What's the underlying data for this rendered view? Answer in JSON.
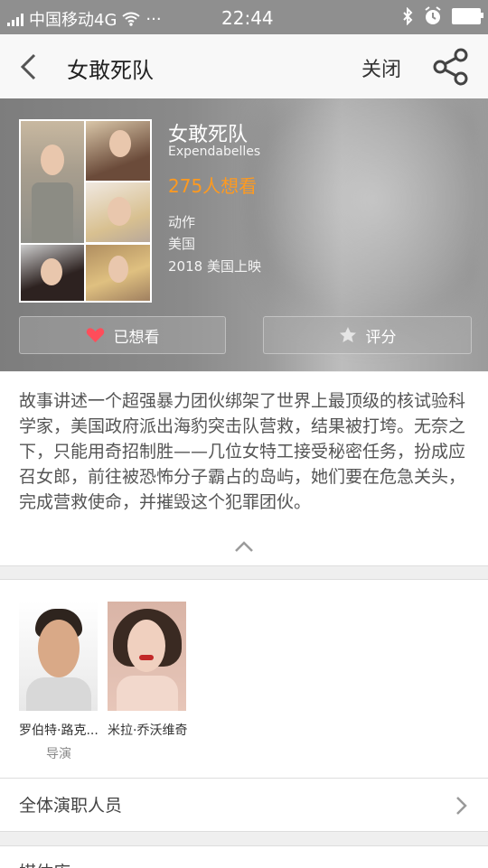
{
  "status_bar": {
    "carrier": "中国移动4G",
    "dots": "···",
    "time": "22:44"
  },
  "header": {
    "title": "女敢死队",
    "close_label": "关闭"
  },
  "movie": {
    "title": "女敢死队",
    "english_title": "Expendabelles",
    "want_count": "275人想看",
    "genre": "动作",
    "country": "美国",
    "release": "2018 美国上映"
  },
  "actions": {
    "want_label": "已想看",
    "rate_label": "评分",
    "accent_color": "#ff9a1f"
  },
  "summary": {
    "text": "故事讲述一个超强暴力团伙绑架了世界上最顶级的核试验科学家，美国政府派出海豹突击队营救，结果被打垮。无奈之下，只能用奇招制胜——几位女特工接受秘密任务，扮成应召女郎，前往被恐怖分子霸占的岛屿，她们要在危急关头，完成营救使命，并摧毁这个犯罪团伙。"
  },
  "cast": [
    {
      "name": "罗伯特·路克...",
      "role": "导演"
    },
    {
      "name": "米拉·乔沃维奇",
      "role": ""
    }
  ],
  "crew_link": {
    "label": "全体演职人员"
  },
  "next_section": {
    "label": "媒体库"
  }
}
